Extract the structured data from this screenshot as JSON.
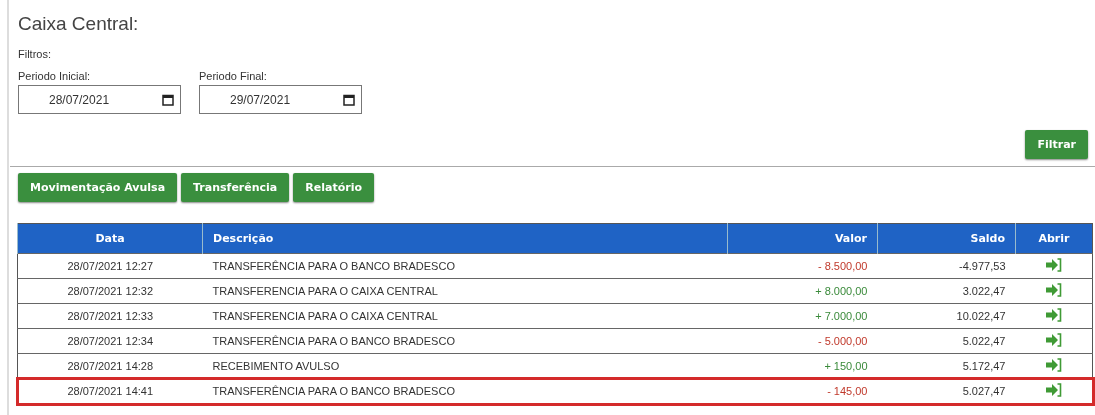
{
  "title": "Caixa Central:",
  "filters": {
    "heading": "Filtros:",
    "fields": [
      {
        "label": "Periodo Inicial:",
        "value": "28/07/2021"
      },
      {
        "label": "Periodo Final:",
        "value": "29/07/2021"
      }
    ],
    "button": "Filtrar"
  },
  "actions": [
    "Movimentação Avulsa",
    "Transferência",
    "Relatório"
  ],
  "table": {
    "columns": [
      "Data",
      "Descrição",
      "Valor",
      "Saldo",
      "Abrir"
    ],
    "rows": [
      {
        "date": "28/07/2021 12:27",
        "description": "TRANSFERÊNCIA PARA O BANCO BRADESCO",
        "value": "- 8.500,00",
        "kind": "debit",
        "balance": "-4.977,53",
        "highlighted": false
      },
      {
        "date": "28/07/2021 12:32",
        "description": "TRANSFERENCIA PARA O CAIXA CENTRAL",
        "value": "+ 8.000,00",
        "kind": "credit",
        "balance": "3.022,47",
        "highlighted": false
      },
      {
        "date": "28/07/2021 12:33",
        "description": "TRANSFERENCIA PARA O CAIXA CENTRAL",
        "value": "+ 7.000,00",
        "kind": "credit",
        "balance": "10.022,47",
        "highlighted": false
      },
      {
        "date": "28/07/2021 12:34",
        "description": "TRANSFERÊNCIA PARA O BANCO BRADESCO",
        "value": "- 5.000,00",
        "kind": "debit",
        "balance": "5.022,47",
        "highlighted": false
      },
      {
        "date": "28/07/2021 14:28",
        "description": "RECEBIMENTO AVULSO",
        "value": "+ 150,00",
        "kind": "credit",
        "balance": "5.172,47",
        "highlighted": false
      },
      {
        "date": "28/07/2021 14:41",
        "description": "TRANSFERÊNCIA PARA O BANCO BRADESCO",
        "value": "- 145,00",
        "kind": "debit",
        "balance": "5.027,47",
        "highlighted": true
      }
    ]
  }
}
